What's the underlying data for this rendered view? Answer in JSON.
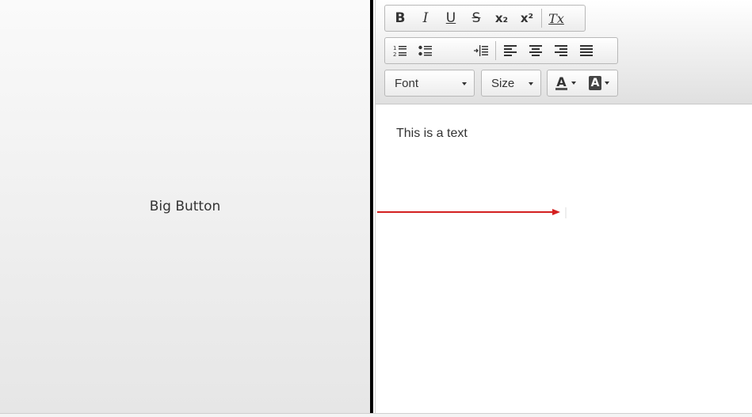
{
  "big_button": {
    "label": "Big Button"
  },
  "toolbar": {
    "basic": [
      {
        "name": "bold-button",
        "icon": "bold-icon",
        "glyph": "B"
      },
      {
        "name": "italic-button",
        "icon": "italic-icon",
        "glyph": "I"
      },
      {
        "name": "underline-button",
        "icon": "underline-icon",
        "glyph": "U"
      },
      {
        "name": "strike-button",
        "icon": "strikethrough-icon",
        "glyph": "S"
      },
      {
        "name": "subscript-button",
        "icon": "subscript-icon",
        "glyph": "x₂"
      },
      {
        "name": "superscript-button",
        "icon": "superscript-icon",
        "glyph": "x²"
      },
      {
        "name": "remove-format-button",
        "icon": "remove-format-icon",
        "glyph": "Tx"
      }
    ],
    "paragraph": [
      {
        "name": "numbered-list-button",
        "icon": "numbered-list-icon"
      },
      {
        "name": "bulleted-list-button",
        "icon": "bulleted-list-icon"
      },
      {
        "name": "indent-button",
        "icon": "indent-icon"
      },
      {
        "name": "align-left-button",
        "icon": "align-left-icon"
      },
      {
        "name": "align-center-button",
        "icon": "align-center-icon"
      },
      {
        "name": "align-right-button",
        "icon": "align-right-icon"
      },
      {
        "name": "align-justify-button",
        "icon": "align-justify-icon"
      }
    ],
    "font_label": "Font",
    "size_label": "Size",
    "text_color_glyph": "A",
    "bg_color_glyph": "A"
  },
  "content": {
    "text": "This is a text"
  },
  "colors": {
    "arrow": "#d42020",
    "splitter": "#000000"
  }
}
